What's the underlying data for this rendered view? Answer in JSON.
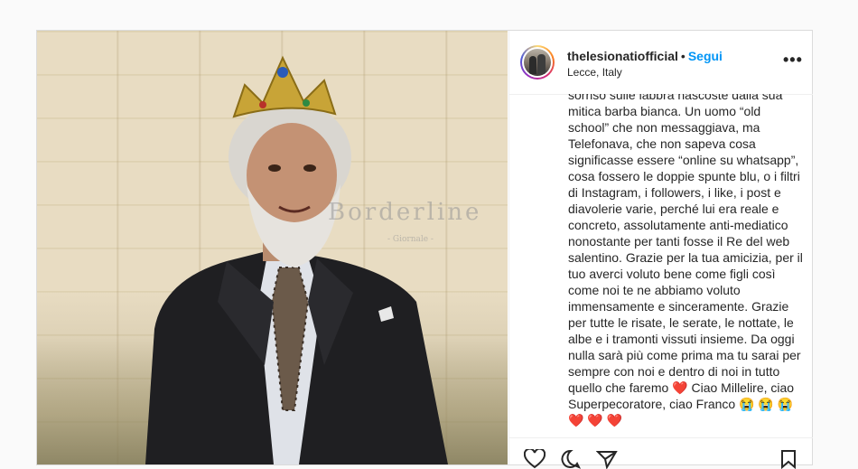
{
  "post": {
    "username": "thelesionatiofficial",
    "separator": "•",
    "follow_label": "Segui",
    "location": "Lecce, Italy",
    "more_icon": "more-options-icon",
    "more_label": "•••"
  },
  "photo": {
    "watermark": "Borderline",
    "watermark_sub": "- Giornale -"
  },
  "caption": {
    "text": "sorriso sulle labbra nascoste dalla sua mitica barba bianca. Un uomo “old school” che non messaggiava, ma Telefonava, che non sapeva cosa significasse essere “online su whatsapp”, cosa fossero le doppie spunte blu, o i filtri di Instagram, i followers, i like, i post e diavolerie varie, perché lui era reale e concreto, assolutamente anti-mediatico nonostante per tanti fosse il Re del web salentino. Grazie per la tua amicizia, per il tuo averci voluto bene come figli così come noi te ne abbiamo voluto immensamente e sinceramente. Grazie per tutte le risate, le serate, le nottate, le albe e i tramonti vissuti insieme. Da oggi nulla sarà più come prima ma tu sarai per sempre con noi e dentro di noi in tutto quello che faremo ❤️  Ciao Millelire, ciao Superpecoratore, ciao Franco 😭 😭 😭\n❤️ ❤️ ❤️"
  },
  "colors": {
    "link": "#0095f6",
    "text": "#262626",
    "border": "#dbdbdb"
  }
}
